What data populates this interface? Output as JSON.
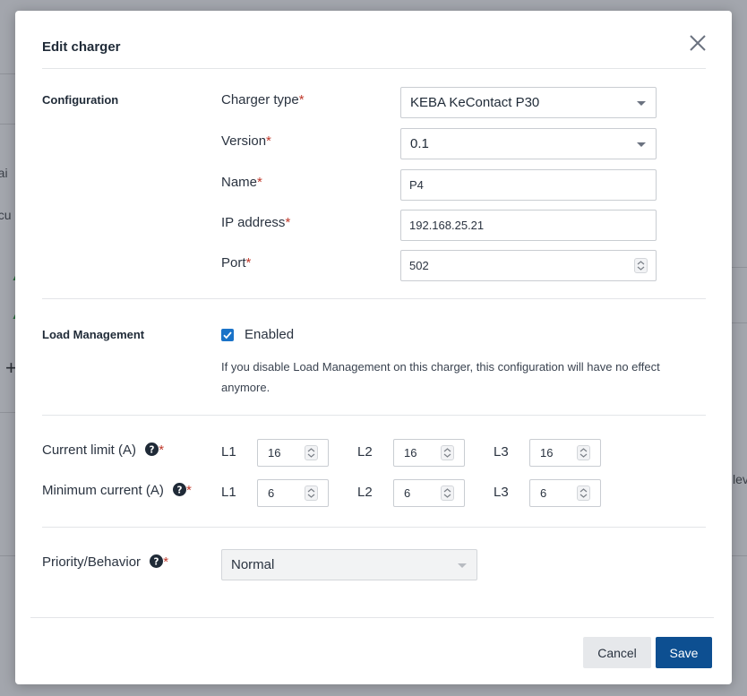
{
  "background": {
    "frag_main": "Mai",
    "frag_secu": "ecu",
    "frag_dev": "lev",
    "plus_glyph": "+"
  },
  "modal": {
    "title": "Edit charger",
    "close_icon": "close-icon"
  },
  "configuration": {
    "section_title": "Configuration",
    "charger_type": {
      "label": "Charger type",
      "value": "KEBA KeContact P30"
    },
    "version": {
      "label": "Version",
      "value": "0.1"
    },
    "name": {
      "label": "Name",
      "value": "P4"
    },
    "ip_address": {
      "label": "IP address",
      "value": "192.168.25.21"
    },
    "port": {
      "label": "Port",
      "value": "502"
    },
    "required_mark": "*"
  },
  "load_management": {
    "section_title": "Load Management",
    "enabled_label": "Enabled",
    "enabled": true,
    "note": "If you disable Load Management on this charger, this configuration will have no effect anymore."
  },
  "current_limit": {
    "label": "Current limit (A)",
    "phases": [
      {
        "name": "L1",
        "value": "16"
      },
      {
        "name": "L2",
        "value": "16"
      },
      {
        "name": "L3",
        "value": "16"
      }
    ]
  },
  "minimum_current": {
    "label": "Minimum current (A)",
    "phases": [
      {
        "name": "L1",
        "value": "6"
      },
      {
        "name": "L2",
        "value": "6"
      },
      {
        "name": "L3",
        "value": "6"
      }
    ]
  },
  "priority": {
    "label": "Priority/Behavior",
    "value": "Normal"
  },
  "buttons": {
    "cancel": "Cancel",
    "save": "Save"
  },
  "colors": {
    "accent": "#0d4f91",
    "checkbox": "#1a73c8",
    "required": "#c0392b"
  }
}
